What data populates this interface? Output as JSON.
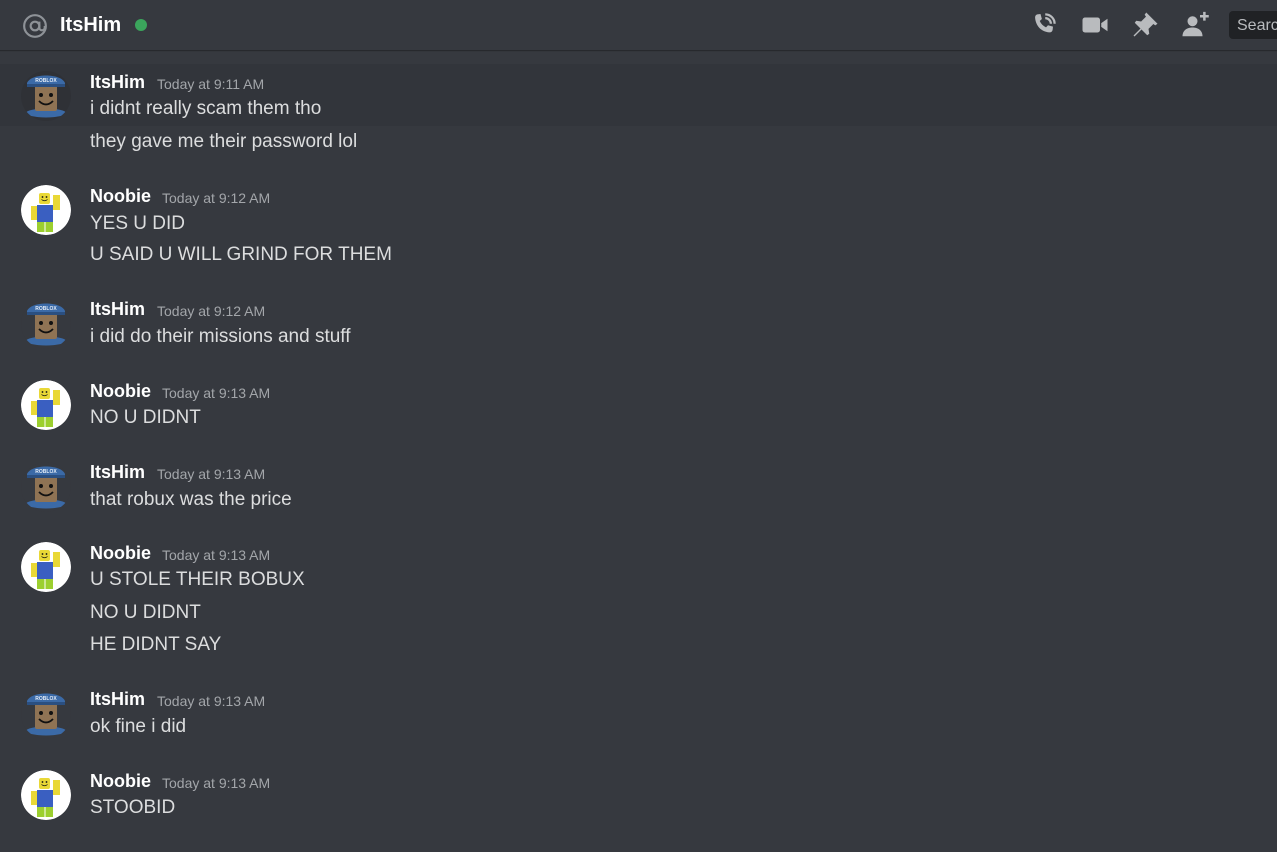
{
  "header": {
    "channel_name": "ItsHim",
    "status": "online",
    "status_color": "#3ba55c",
    "icons": [
      "at-icon",
      "voice-call-icon",
      "video-call-icon",
      "pin-icon",
      "add-friend-icon"
    ],
    "search_placeholder": "Search"
  },
  "messages": [
    {
      "author": "ItsHim",
      "time": "Today at 9:11 AM",
      "avatar": "roblox-guest-avatar",
      "lines": [
        "i didnt really scam them tho",
        "they gave me their password lol"
      ]
    },
    {
      "author": "Noobie",
      "time": "Today at 9:12 AM",
      "avatar": "roblox-noob-avatar",
      "lines": [
        "YES U DID",
        "U SAID U WILL GRIND FOR THEM"
      ]
    },
    {
      "author": "ItsHim",
      "time": "Today at 9:12 AM",
      "avatar": "roblox-guest-avatar",
      "lines": [
        "i did do their missions and stuff"
      ]
    },
    {
      "author": "Noobie",
      "time": "Today at 9:13 AM",
      "avatar": "roblox-noob-avatar",
      "lines": [
        "NO U DIDNT"
      ]
    },
    {
      "author": "ItsHim",
      "time": "Today at 9:13 AM",
      "avatar": "roblox-guest-avatar",
      "lines": [
        "that robux was the price"
      ]
    },
    {
      "author": "Noobie",
      "time": "Today at 9:13 AM",
      "avatar": "roblox-noob-avatar",
      "lines": [
        "U STOLE THEIR BOBUX",
        "NO U DIDNT",
        "HE DIDNT SAY"
      ]
    },
    {
      "author": "ItsHim",
      "time": "Today at 9:13 AM",
      "avatar": "roblox-guest-avatar",
      "lines": [
        "ok fine i did"
      ]
    },
    {
      "author": "Noobie",
      "time": "Today at 9:13 AM",
      "avatar": "roblox-noob-avatar",
      "lines": [
        "STOOBID"
      ]
    }
  ]
}
